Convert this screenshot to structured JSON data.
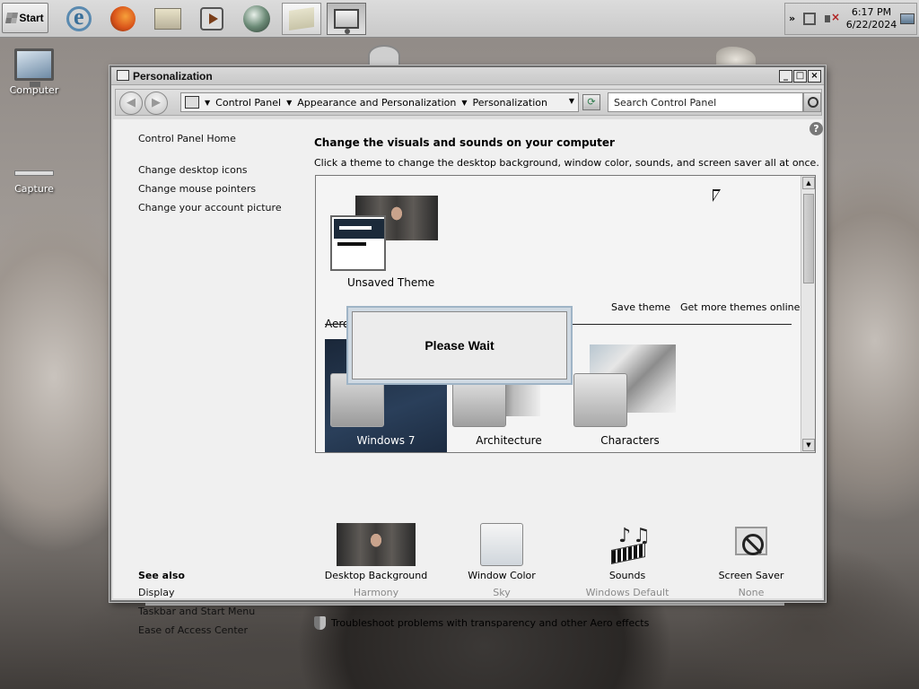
{
  "taskbar": {
    "start_label": "Start",
    "icons": [
      "internet-explorer-icon",
      "firefox-icon",
      "file-explorer-icon",
      "media-player-icon",
      "orb-app-icon",
      "folder-icon",
      "control-panel-icon"
    ],
    "clock": {
      "time": "6:17 PM",
      "date": "6/22/2024"
    }
  },
  "desktop": {
    "icons": [
      {
        "label": "Computer",
        "icon": "computer-icon"
      },
      {
        "label": "Capture",
        "icon": "capture-icon"
      }
    ]
  },
  "window": {
    "title": "Personalization",
    "address": {
      "crumbs": [
        "Control Panel",
        "Appearance and Personalization",
        "Personalization"
      ]
    },
    "search": {
      "placeholder": "Search Control Panel"
    },
    "sidebar": {
      "home": "Control Panel Home",
      "links": [
        "Change desktop icons",
        "Change mouse pointers",
        "Change your account picture"
      ],
      "see_also_heading": "See also",
      "see_also": [
        "Display",
        "Taskbar and Start Menu",
        "Ease of Access Center"
      ]
    },
    "main": {
      "heading": "Change the visuals and sounds on your computer",
      "subheading": "Click a theme to change the desktop background, window color, sounds, and screen saver all at once.",
      "my_theme": "Unsaved Theme",
      "save_theme": "Save theme",
      "get_more": "Get more themes online",
      "section_label": "Aero",
      "themes": [
        "Windows 7",
        "Architecture",
        "Characters"
      ],
      "bottom": [
        {
          "label": "Desktop Background",
          "value": "Harmony"
        },
        {
          "label": "Window Color",
          "value": "Sky"
        },
        {
          "label": "Sounds",
          "value": "Windows Default"
        },
        {
          "label": "Screen Saver",
          "value": "None"
        }
      ],
      "troubleshoot": "Troubleshoot problems with transparency and other Aero effects"
    }
  },
  "dialog": {
    "message": "Please Wait"
  }
}
